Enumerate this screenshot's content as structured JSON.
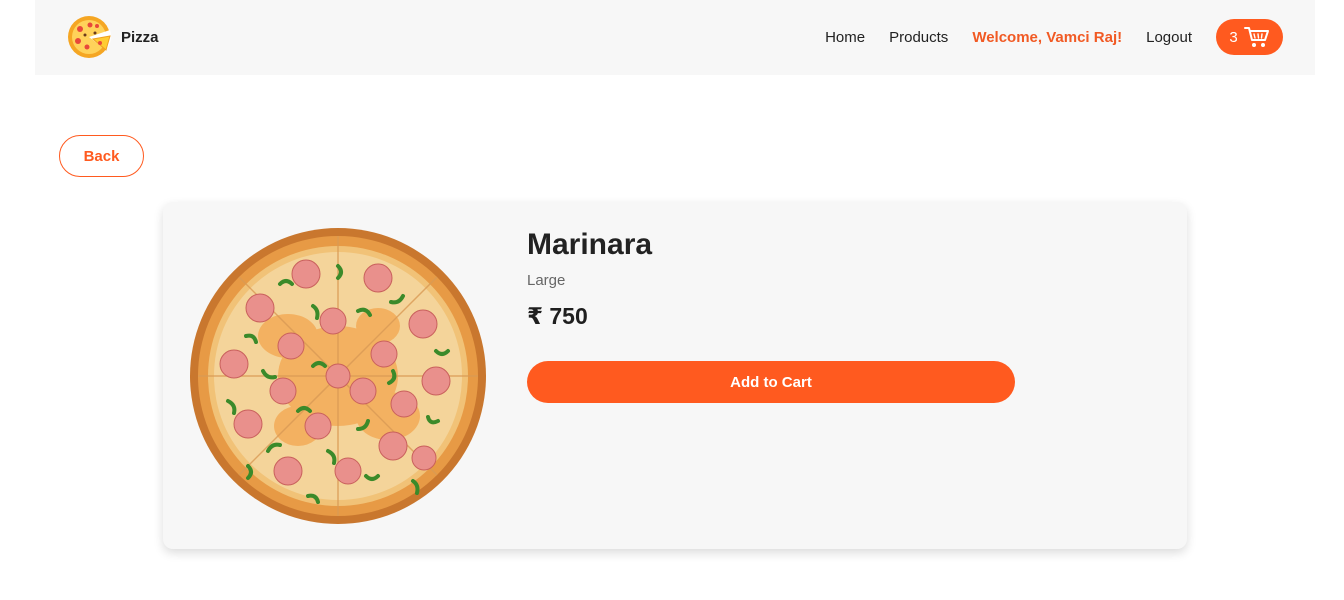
{
  "brand": {
    "name": "Pizza",
    "logo_icon": "pizza-logo-icon"
  },
  "nav": {
    "home": "Home",
    "products": "Products",
    "welcome": "Welcome, Vamci Raj!",
    "logout": "Logout",
    "cart_count": "3",
    "cart_icon": "shopping-cart-icon"
  },
  "back_label": "Back",
  "product": {
    "name": "Marinara",
    "size": "Large",
    "price": "₹ 750",
    "image_icon": "pizza-image",
    "add_to_cart_label": "Add to Cart"
  },
  "colors": {
    "accent": "#ff5a1f",
    "navbar_bg": "#f7f7f7",
    "card_bg": "#f7f7f7",
    "welcome_text": "#f15a24"
  }
}
